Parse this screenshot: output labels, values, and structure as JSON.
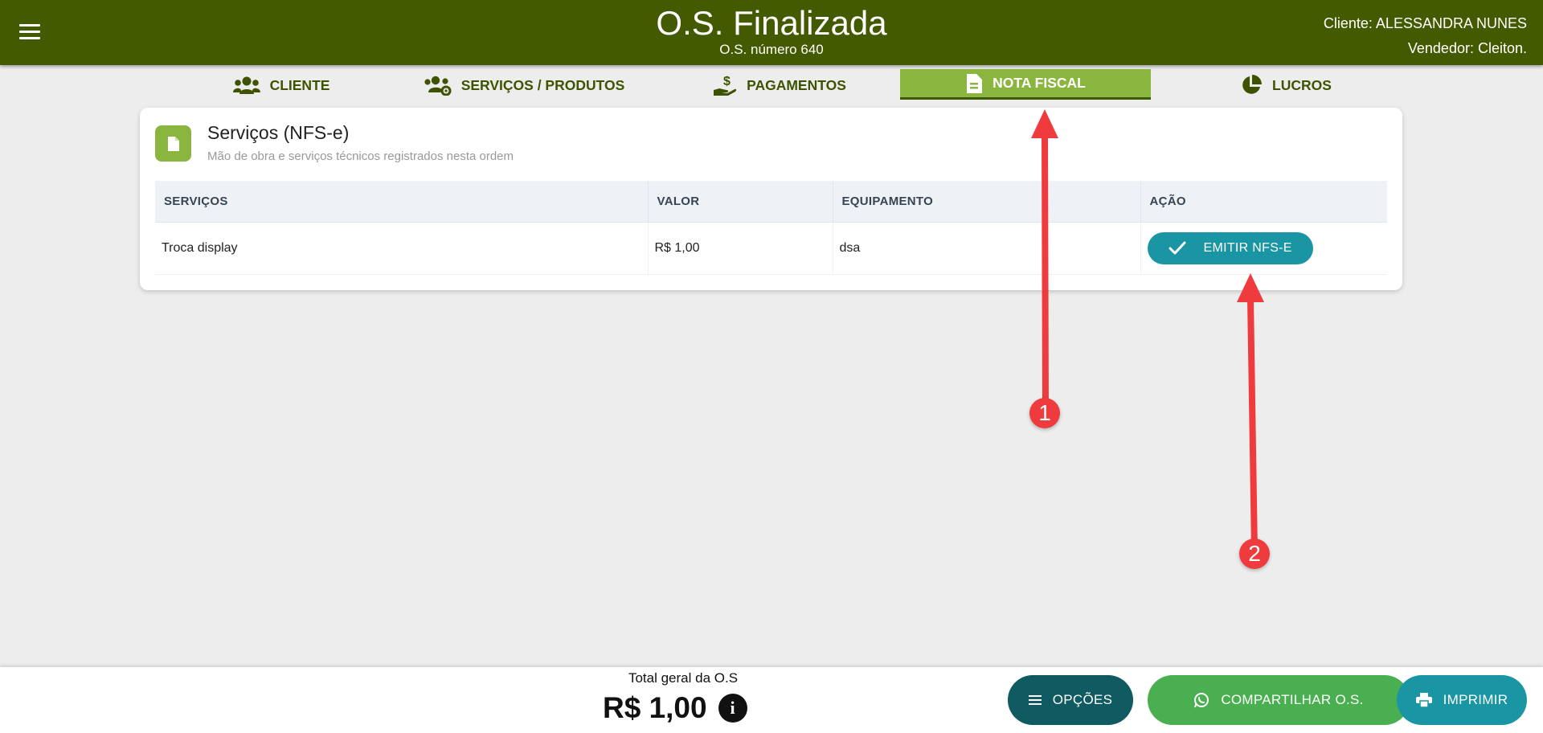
{
  "header": {
    "title": "O.S. Finalizada",
    "subtitle": "O.S. número 640",
    "client": "Cliente: ALESSANDRA NUNES",
    "seller": "Vendedor: Cleiton.",
    "bg_color": "#435a00"
  },
  "tabs": [
    {
      "label": "CLIENTE",
      "icon": "users-icon"
    },
    {
      "label": "SERVIÇOS / PRODUTOS",
      "icon": "users-gear-icon"
    },
    {
      "label": "PAGAMENTOS",
      "icon": "hand-dollar-icon"
    },
    {
      "label": "NOTA FISCAL",
      "icon": "file-invoice-icon",
      "active": true
    },
    {
      "label": "LUCROS",
      "icon": "pie-chart-icon"
    }
  ],
  "card": {
    "title": "Serviços (NFS-e)",
    "subtitle": "Mão de obra e serviços técnicos registrados nesta ordem",
    "columns": [
      "SERVIÇOS",
      "VALOR",
      "EQUIPAMENTO",
      "AÇÃO"
    ],
    "rows": [
      {
        "servico": "Troca display",
        "valor": "R$ 1,00",
        "equipamento": "dsa",
        "acao": "EMITIR NFS-E"
      }
    ]
  },
  "annotations": {
    "badge1": "1",
    "badge2": "2",
    "color": "#ef3b3d"
  },
  "footer": {
    "total_label": "Total geral da O.S",
    "total_value": "R$ 1,00",
    "buttons": {
      "options": "OPÇÕES",
      "share": "COMPARTILHAR O.S.",
      "print": "IMPRIMIR"
    }
  },
  "colors": {
    "accent_green": "#8ab640",
    "teal": "#1a95a4",
    "whatsapp_green": "#4aaf50",
    "dark_teal": "#0f5b61"
  }
}
